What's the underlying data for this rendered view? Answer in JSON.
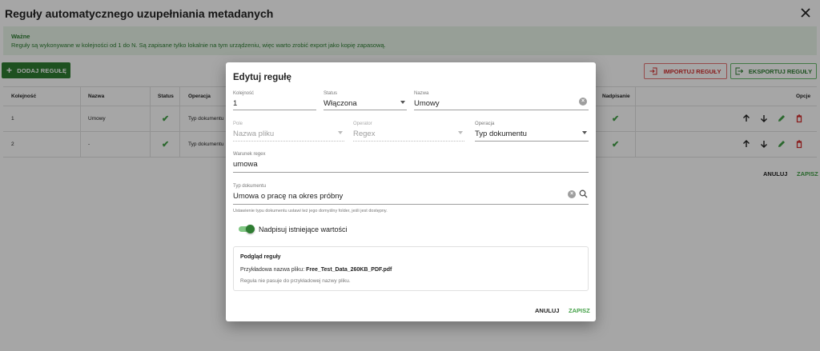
{
  "page": {
    "title": "Reguły automatycznego uzupełniania metadanych",
    "notice_title": "Ważne",
    "notice_text": "Reguły są wykonywane w kolejności od 1 do N. Są zapisane tylko lokalnie na tym urządzeniu, więc warto zrobić export jako kopię zapasową.",
    "add_rule_label": "DODAJ REGUŁĘ",
    "import_label": "IMPORTUJ REGUŁY",
    "export_label": "EKSPORTUJ REGUŁY",
    "cancel_label": "ANULUJ",
    "save_label": "ZAPISZ"
  },
  "table": {
    "headers": {
      "order": "Kolejność",
      "name": "Nazwa",
      "status": "Status",
      "operation": "Operacja",
      "overwrite": "Nadpisanie",
      "options": "Opcje"
    },
    "rows": [
      {
        "order": "1",
        "name": "Umowy",
        "operation": "Typ dokumentu"
      },
      {
        "order": "2",
        "name": "-",
        "operation": "Typ dokumentu"
      }
    ]
  },
  "dialog": {
    "title": "Edytuj regułę",
    "order_label": "Kolejność",
    "order_value": "1",
    "status_label": "Status",
    "status_value": "Włączona",
    "name_label": "Nazwa",
    "name_value": "Umowy",
    "field_label": "Pole",
    "field_value": "Nazwa pliku",
    "operator_label": "Operator",
    "operator_value": "Regex",
    "operation_label": "Operacja",
    "operation_value": "Typ dokumentu",
    "regex_label": "Warunek regex",
    "regex_value": "umowa",
    "doctype_label": "Typ dokumentu",
    "doctype_value": "Umowa o pracę na okres próbny",
    "helper_text": "Ustawienie typu dokumentu ustawi też jego domyślny folder, jeśli jest dostępny.",
    "overwrite_label": "Nadpisuj istniejące wartości",
    "overwrite_enabled": true,
    "preview_title": "Podgląd reguły",
    "preview_example_prefix": "Przykładowa nazwa pliku:",
    "preview_example_file": "Free_Test_Data_260KB_PDF.pdf",
    "preview_note": "Reguła nie pasuje do przykładowej nazwy pliku.",
    "cancel_label": "ANULUJ",
    "save_label": "ZAPISZ"
  },
  "colors": {
    "accent": "#2e7d32",
    "danger": "#d32f2f"
  }
}
